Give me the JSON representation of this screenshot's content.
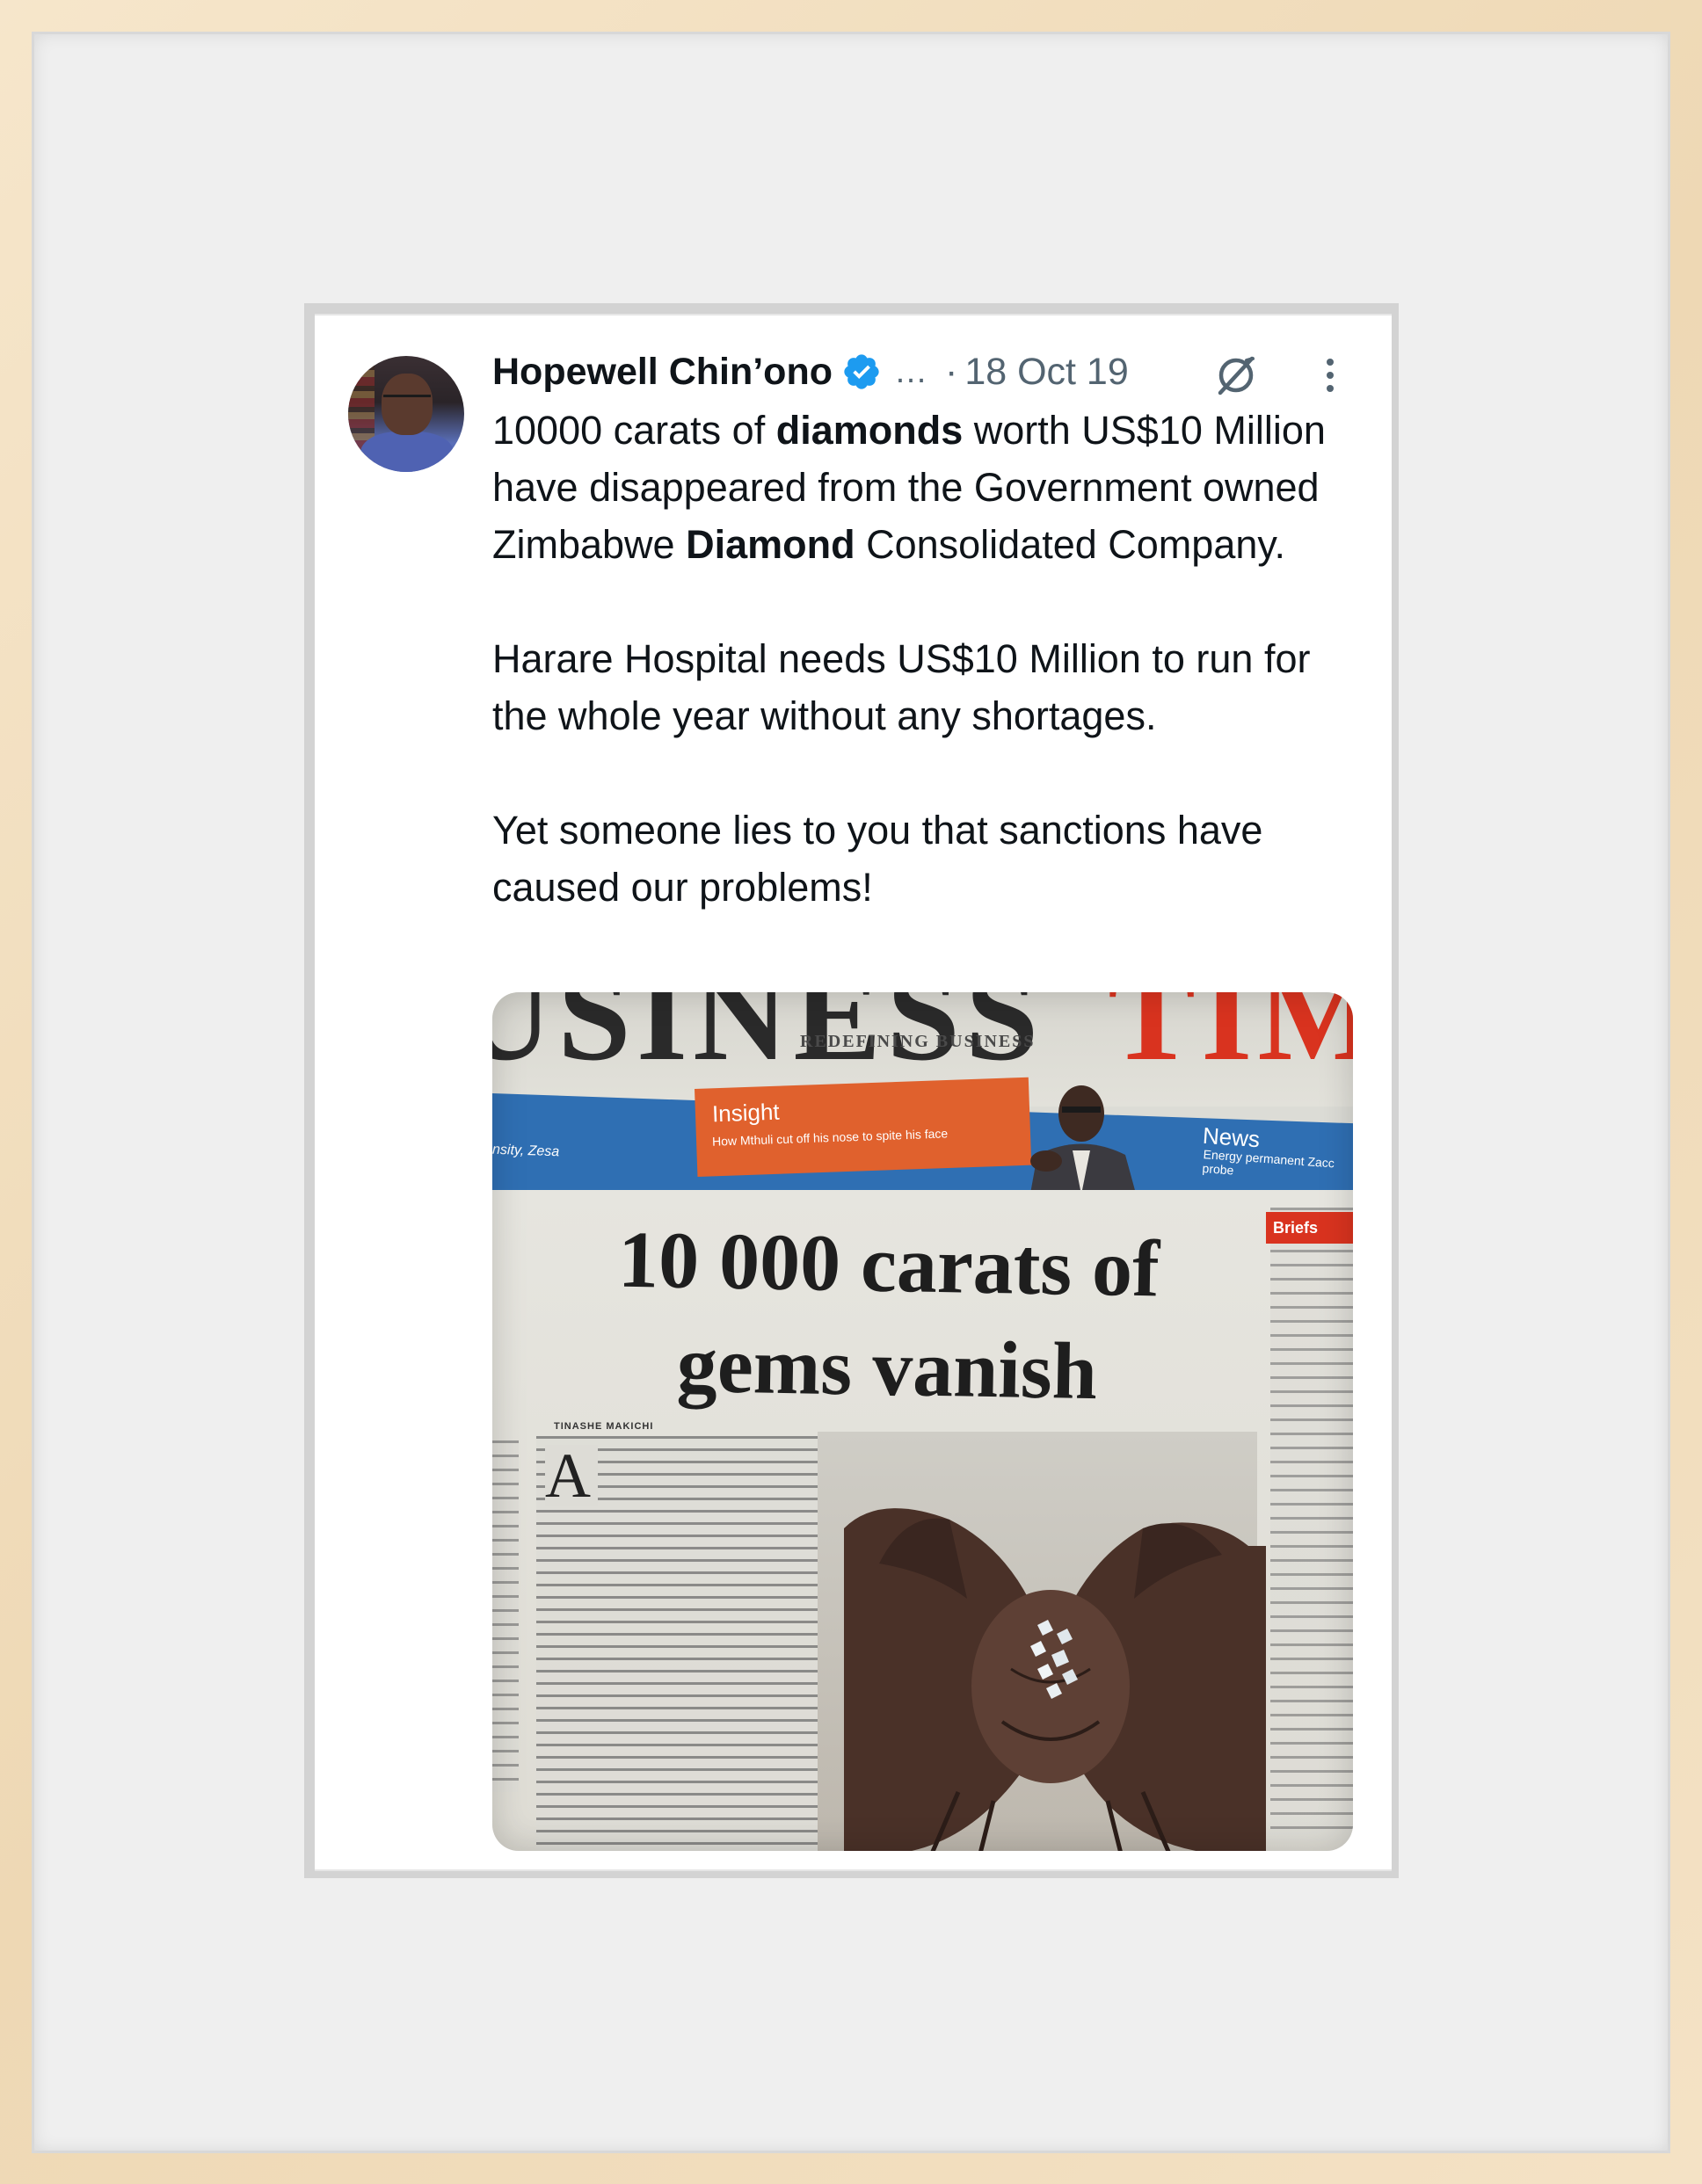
{
  "tweet": {
    "author_name": "Hopewell Chin’ono",
    "ellipsis": "…",
    "dot": "·",
    "date": "18 Oct 19",
    "paragraphs": [
      [
        {
          "text": "10000 carats of ",
          "bold": false
        },
        {
          "text": "diamonds",
          "bold": true
        },
        {
          "text": " worth US$10 Million have disappeared from the Government owned Zimbabwe ",
          "bold": false
        },
        {
          "text": "Diamond",
          "bold": true
        },
        {
          "text": " Consolidated Company.",
          "bold": false
        }
      ],
      [
        {
          "text": "Harare Hospital needs US$10 Million to run for the whole year without any shortages.",
          "bold": false
        }
      ],
      [
        {
          "text": "Yet someone lies to you that sanctions have caused our problems!",
          "bold": false
        }
      ]
    ],
    "icons": {
      "verified": "verified-badge-icon",
      "grok": "grok-icon",
      "more": "more-vertical-icon"
    },
    "colors": {
      "verified_blue": "#1d9bf0",
      "text_primary": "#0f1419",
      "text_secondary": "#536471"
    }
  },
  "media": {
    "masthead_left": "USINESS",
    "masthead_right": "TIM",
    "tagline": "REDEFINING BUSINESS",
    "band_left": "nsity, Zesa",
    "band_insight": "Insight",
    "band_insight_sub": "How Mthuli cut off his nose to spite his face",
    "band_news": "News",
    "band_news_sub": "Energy permanent Zacc probe",
    "headline_line1": "10 000 carats of",
    "headline_line2": "gems vanish",
    "byline": "TINASHE MAKICHI",
    "dropcap": "A",
    "briefs_label": "Briefs"
  }
}
